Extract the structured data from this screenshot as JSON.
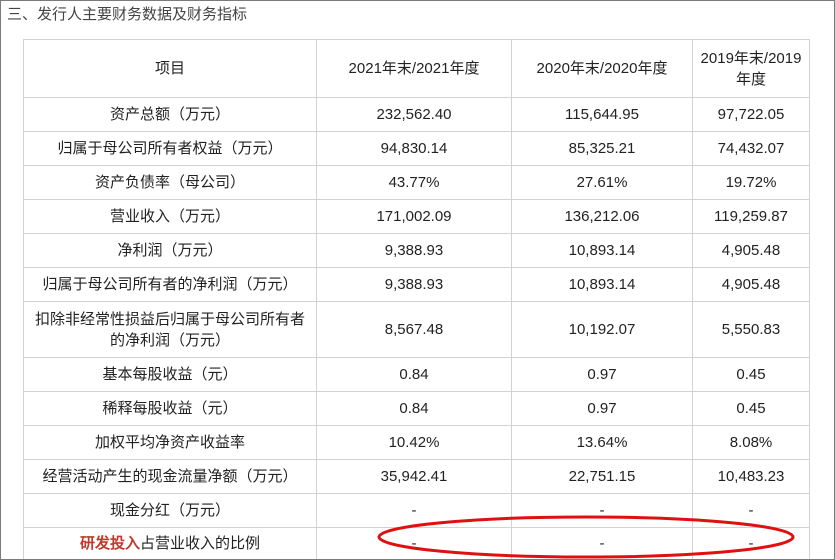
{
  "section_title": "三、发行人主要财务数据及财务指标",
  "table": {
    "headers": [
      "项目",
      "2021年末/2021年度",
      "2020年末/2020年度",
      "2019年末/2019年度"
    ],
    "rows": [
      {
        "label": "资产总额（万元）",
        "values": [
          "232,562.40",
          "115,644.95",
          "97,722.05"
        ]
      },
      {
        "label": "归属于母公司所有者权益（万元）",
        "values": [
          "94,830.14",
          "85,325.21",
          "74,432.07"
        ]
      },
      {
        "label": "资产负债率（母公司）",
        "values": [
          "43.77%",
          "27.61%",
          "19.72%"
        ]
      },
      {
        "label": "营业收入（万元）",
        "values": [
          "171,002.09",
          "136,212.06",
          "119,259.87"
        ]
      },
      {
        "label": "净利润（万元）",
        "values": [
          "9,388.93",
          "10,893.14",
          "4,905.48"
        ]
      },
      {
        "label": "归属于母公司所有者的净利润（万元）",
        "values": [
          "9,388.93",
          "10,893.14",
          "4,905.48"
        ]
      },
      {
        "label": "扣除非经常性损益后归属于母公司所有者的净利润（万元）",
        "values": [
          "8,567.48",
          "10,192.07",
          "5,550.83"
        ]
      },
      {
        "label": "基本每股收益（元）",
        "values": [
          "0.84",
          "0.97",
          "0.45"
        ]
      },
      {
        "label": "稀释每股收益（元）",
        "values": [
          "0.84",
          "0.97",
          "0.45"
        ]
      },
      {
        "label": "加权平均净资产收益率",
        "values": [
          "10.42%",
          "13.64%",
          "8.08%"
        ]
      },
      {
        "label": "经营活动产生的现金流量净额（万元）",
        "values": [
          "35,942.41",
          "22,751.15",
          "10,483.23"
        ]
      },
      {
        "label": "现金分红（万元）",
        "values": [
          "-",
          "-",
          "-"
        ]
      }
    ],
    "last_row": {
      "label_highlight": "研发投入",
      "label_rest": "占营业收入的比例",
      "values": [
        "-",
        "-",
        "-"
      ]
    }
  },
  "colors": {
    "highlight": "#c0392b",
    "ellipse": "#e01010",
    "grid": "#d2d2d2"
  }
}
